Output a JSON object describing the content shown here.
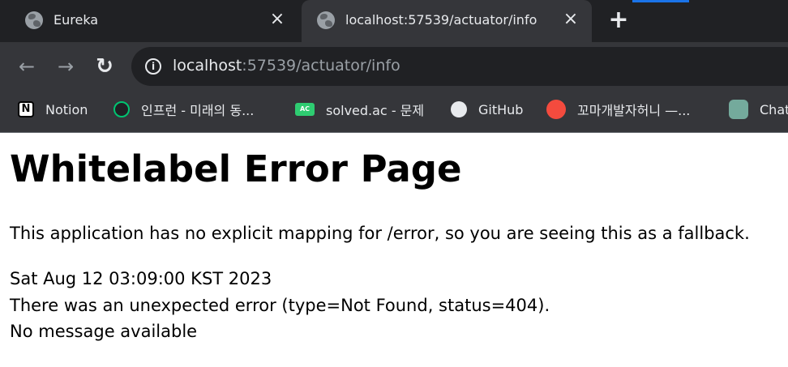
{
  "tabs": [
    {
      "title": "Eureka",
      "active": false,
      "icon": "globe-icon"
    },
    {
      "title": "localhost:57539/actuator/info",
      "active": true,
      "icon": "globe-icon"
    }
  ],
  "toolbar": {
    "url_host": "localhost",
    "url_rest": ":57539/actuator/info"
  },
  "bookmarks": [
    {
      "label": "Notion",
      "icon": "notion-icon"
    },
    {
      "label": "인프런 - 미래의 동...",
      "icon": "inflearn-icon"
    },
    {
      "label": "solved.ac - 문제",
      "icon": "solved-ac-icon",
      "icon_text": "AC"
    },
    {
      "label": "GitHub",
      "icon": "github-icon"
    },
    {
      "label": "꼬마개발자허니 —...",
      "icon": "tistory-icon"
    },
    {
      "label": "Chat",
      "icon": "chatgpt-icon"
    }
  ],
  "page": {
    "heading": "Whitelabel Error Page",
    "description": "This application has no explicit mapping for /error, so you are seeing this as a fallback.",
    "timestamp": "Sat Aug 12 03:09:00 KST 2023",
    "error": "There was an unexpected error (type=Not Found, status=404).",
    "message": "No message available"
  },
  "icons": {
    "close": "×",
    "new_tab": "+",
    "back": "←",
    "forward": "→",
    "reload": "↻",
    "info": "i",
    "notion": "N"
  },
  "colors": {
    "chrome_dark": "#202124",
    "chrome_tab": "#35363a",
    "text_light": "#e8eaed",
    "text_muted": "#9aa0a6",
    "accent": "#1a73e8"
  }
}
